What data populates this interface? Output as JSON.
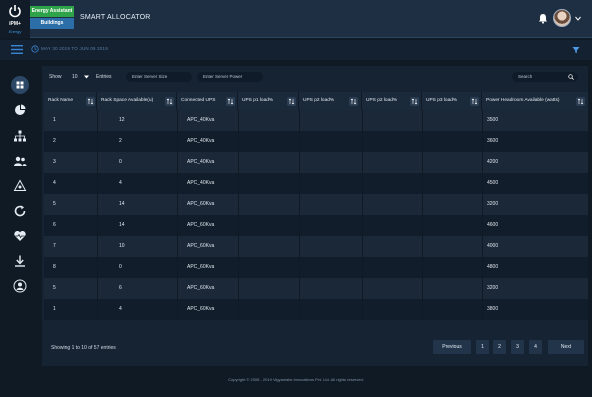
{
  "header": {
    "brand": "iPM+",
    "brand_sub": "Energy",
    "tag_energy": "Energy Assistant",
    "tag_buildings": "Buildings",
    "title": "SMART ALLOCATOR"
  },
  "subheader": {
    "info": "MAY 30 2019 TO JUN 05 2019"
  },
  "controls": {
    "show_label": "Show",
    "entries_value": "10",
    "entries_label": "Entries",
    "server_size_placeholder": "Enter Server Size",
    "server_power_placeholder": "Enter Server Power",
    "search_placeholder": "Search"
  },
  "table": {
    "headers": [
      "Rack Name",
      "Rack Space Available(u)",
      "Connected UPS",
      "UPS p1 load%",
      "UPS p2 load%",
      "UPS p2 load%",
      "UPS p3 load%",
      "Power Headroom Available (watts)"
    ],
    "rows": [
      {
        "rack": "1",
        "space": "12",
        "ups": "APC_40Kva",
        "p1": "",
        "p2": "",
        "p2b": "",
        "p3": "",
        "power": "3500"
      },
      {
        "rack": "2",
        "space": "2",
        "ups": "APC_40Kva",
        "p1": "",
        "p2": "",
        "p2b": "",
        "p3": "",
        "power": "3600"
      },
      {
        "rack": "3",
        "space": "0",
        "ups": "APC_40Kva",
        "p1": "",
        "p2": "",
        "p2b": "",
        "p3": "",
        "power": "4200"
      },
      {
        "rack": "4",
        "space": "4",
        "ups": "APC_40Kva",
        "p1": "",
        "p2": "",
        "p2b": "",
        "p3": "",
        "power": "4500"
      },
      {
        "rack": "5",
        "space": "14",
        "ups": "APC_60Kva",
        "p1": "",
        "p2": "",
        "p2b": "",
        "p3": "",
        "power": "3200"
      },
      {
        "rack": "6",
        "space": "14",
        "ups": "APC_60Kva",
        "p1": "",
        "p2": "",
        "p2b": "",
        "p3": "",
        "power": "4600"
      },
      {
        "rack": "7",
        "space": "10",
        "ups": "APC_60Kva",
        "p1": "",
        "p2": "",
        "p2b": "",
        "p3": "",
        "power": "4000"
      },
      {
        "rack": "8",
        "space": "0",
        "ups": "APC_60Kva",
        "p1": "",
        "p2": "",
        "p2b": "",
        "p3": "",
        "power": "4800"
      },
      {
        "rack": "5",
        "space": "6",
        "ups": "APC_60Kva",
        "p1": "",
        "p2": "",
        "p2b": "",
        "p3": "",
        "power": "3200"
      },
      {
        "rack": "1",
        "space": "4",
        "ups": "APC_60Kva",
        "p1": "",
        "p2": "",
        "p2b": "",
        "p3": "",
        "power": "3800"
      }
    ]
  },
  "pagination": {
    "showing": "Showing 1 to 10 of 57 entries",
    "previous": "Previous",
    "pages": [
      "1",
      "2",
      "3",
      "4"
    ],
    "next": "Next"
  },
  "footer": "Copyright © 2008 - 2019 Vigyanlabs Innovations Pvt. Ltd. All rights reserved.",
  "colors": {
    "accent_green": "#2fa34a",
    "accent_blue": "#2c6fa8",
    "header_bg": "#1e2f44"
  }
}
